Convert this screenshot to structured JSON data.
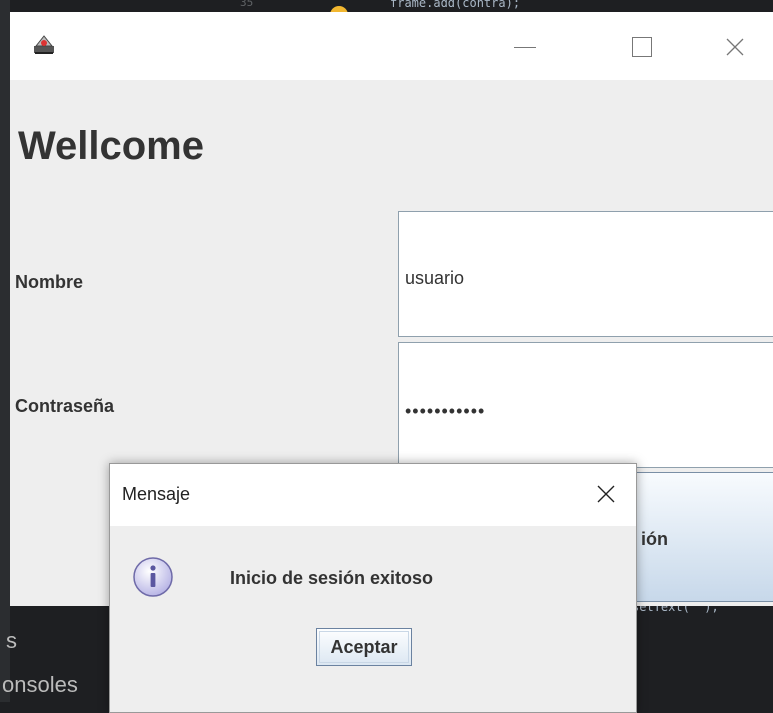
{
  "background": {
    "line_number": "35",
    "code_top": "frame.add(contra);",
    "code_right": "setText(\"\");",
    "side_s": "s",
    "side_consoles": "onsoles"
  },
  "window": {
    "heading": "Wellcome",
    "name_label": "Nombre",
    "password_label": "Contraseña",
    "name_value": "usuario",
    "password_value": "•••••••••••",
    "login_button_visible_text": "ión"
  },
  "dialog": {
    "title": "Mensaje",
    "message": "Inicio de sesión exitoso",
    "accept_label": "Aceptar",
    "icon": "info-icon"
  },
  "colors": {
    "window_bg": "#eeeeee",
    "ide_bg": "#1e1f22",
    "button_border": "#6b82a0"
  }
}
